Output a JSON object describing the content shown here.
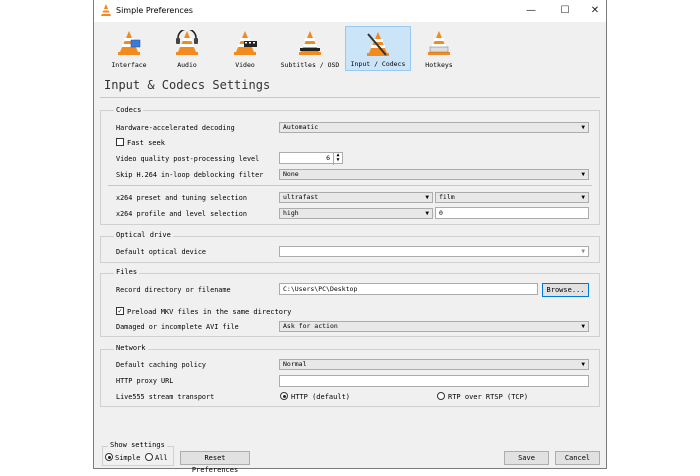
{
  "window": {
    "title": "Simple Preferences",
    "minimize": "—",
    "maximize": "☐",
    "close": "✕"
  },
  "categories": [
    {
      "label": "Interface"
    },
    {
      "label": "Audio"
    },
    {
      "label": "Video"
    },
    {
      "label": "Subtitles / OSD"
    },
    {
      "label": "Input / Codecs"
    },
    {
      "label": "Hotkeys"
    }
  ],
  "heading": "Input & Codecs Settings",
  "codecs": {
    "title": "Codecs",
    "hw_label": "Hardware-accelerated decoding",
    "hw_value": "Automatic",
    "fast_seek_label": "Fast seek",
    "vq_label": "Video quality post-processing level",
    "vq_value": "6",
    "skip_label": "Skip H.264 in-loop deblocking filter",
    "skip_value": "None",
    "x264_preset_label": "x264 preset and tuning selection",
    "x264_preset_value": "ultrafast",
    "x264_tune_value": "film",
    "x264_profile_label": "x264 profile and level selection",
    "x264_profile_value": "high",
    "x264_level_value": "0"
  },
  "optical": {
    "title": "Optical drive",
    "device_label": "Default optical device",
    "device_value": ""
  },
  "files": {
    "title": "Files",
    "record_label": "Record directory or filename",
    "record_value": "C:\\Users\\PC\\Desktop",
    "browse_label": "Browse...",
    "preload_label": "Preload MKV files in the same directory",
    "avi_label": "Damaged or incomplete AVI file",
    "avi_value": "Ask for action"
  },
  "network": {
    "title": "Network",
    "caching_label": "Default caching policy",
    "caching_value": "Normal",
    "proxy_label": "HTTP proxy URL",
    "proxy_value": "",
    "live555_label": "Live555 stream transport",
    "http_label": "HTTP (default)",
    "rtp_label": "RTP over RTSP (TCP)"
  },
  "footer": {
    "show_settings": "Show settings",
    "simple": "Simple",
    "all": "All",
    "reset": "Reset Preferences",
    "save": "Save",
    "cancel": "Cancel"
  },
  "colors": {
    "selected_tab": "#cce4f7",
    "cone_orange": "#f28a1e"
  }
}
